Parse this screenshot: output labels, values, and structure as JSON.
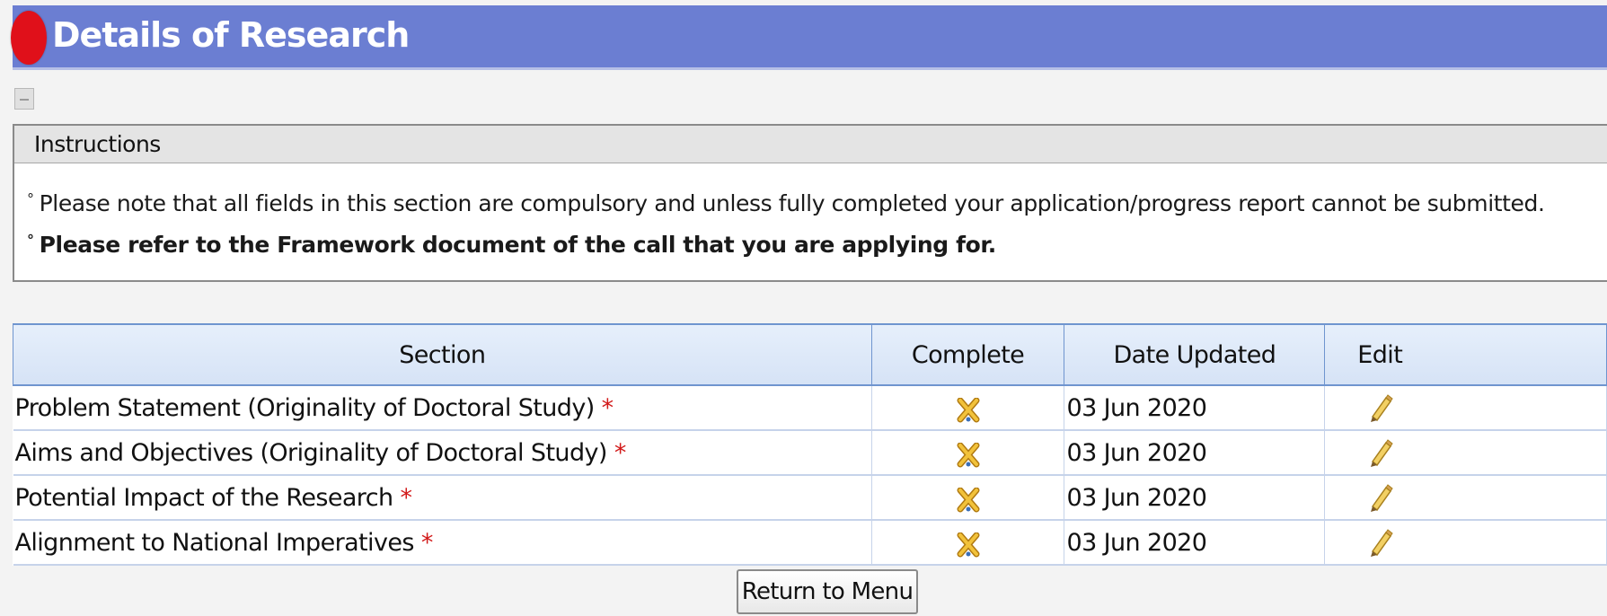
{
  "header": {
    "title": "Details of Research"
  },
  "instructions": {
    "heading": "Instructions",
    "lines": [
      "Please note that all fields in this section are compulsory and unless fully completed your application/progress report cannot be submitted.",
      "Please refer to the Framework document of the call that you are applying for."
    ],
    "bullet": "°"
  },
  "table": {
    "headers": {
      "section": "Section",
      "complete": "Complete",
      "date": "Date Updated",
      "edit": "Edit"
    },
    "required_marker": "*",
    "rows": [
      {
        "section": "Problem Statement (Originality of Doctoral Study)",
        "complete_icon": "incomplete-x-icon",
        "date": "03 Jun 2020",
        "edit_icon": "pencil-icon"
      },
      {
        "section": "Aims and Objectives (Originality of Doctoral Study)",
        "complete_icon": "incomplete-x-icon",
        "date": "03 Jun 2020",
        "edit_icon": "pencil-icon"
      },
      {
        "section": "Potential Impact of the Research",
        "complete_icon": "incomplete-x-icon",
        "date": "03 Jun 2020",
        "edit_icon": "pencil-icon"
      },
      {
        "section": "Alignment to National Imperatives",
        "complete_icon": "incomplete-x-icon",
        "date": "03 Jun 2020",
        "edit_icon": "pencil-icon"
      }
    ]
  },
  "buttons": {
    "return_label": "Return to Menu"
  },
  "colors": {
    "header_bg": "#6b7ed2",
    "required": "#d21a1a",
    "table_border": "#6f95cf"
  }
}
